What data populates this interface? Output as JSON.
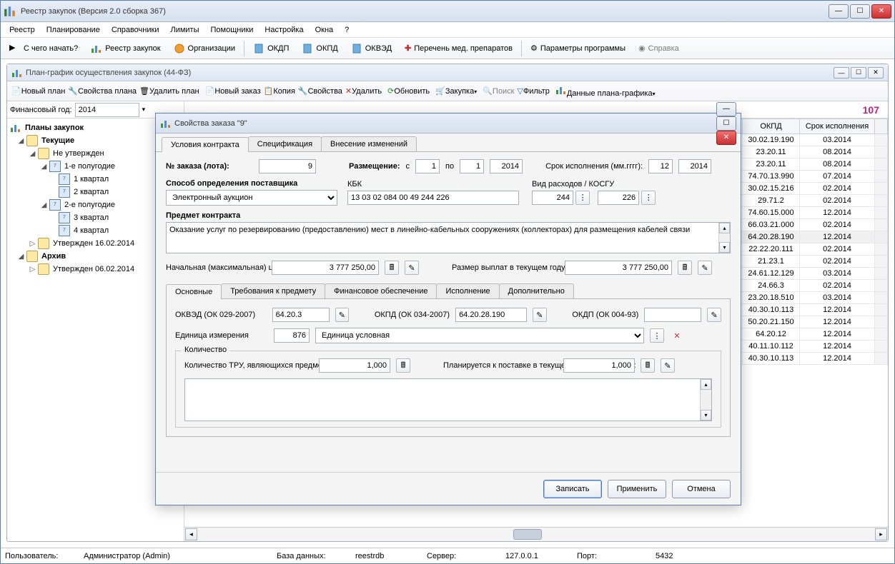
{
  "app": {
    "title": "Реестр закупок (Версия 2.0 сборка 367)"
  },
  "menu": {
    "items": [
      "Реестр",
      "Планирование",
      "Справочники",
      "Лимиты",
      "Помощники",
      "Настройка",
      "Окна",
      "?"
    ]
  },
  "maintb": {
    "start": "С чего начать?",
    "reestr": "Реестр закупок",
    "org": "Организации",
    "okdp": "ОКДП",
    "okpd": "ОКПД",
    "okved": "ОКВЭД",
    "med": "Перечень мед. препаратов",
    "params": "Параметры программы",
    "help": "Справка"
  },
  "doc": {
    "title": "План-график осуществления закупок (44-ФЗ)",
    "tb": {
      "newplan": "Новый план",
      "props": "Свойства плана",
      "delplan": "Удалить план",
      "neworder": "Новый заказ",
      "copy": "Копия",
      "orderprops": "Свойства",
      "delete": "Удалить",
      "refresh": "Обновить",
      "purchase": "Закупка",
      "search": "Поиск",
      "filter": "Фильтр",
      "plandata": "Данные плана-графика"
    },
    "finyear_label": "Финансовый год:",
    "finyear": "2014",
    "count": "107"
  },
  "tree": {
    "root": "Планы закупок",
    "current": "Текущие",
    "not_approved": "Не утвержден",
    "h1": "1-е полугодие",
    "q1": "1 квартал",
    "q2": "2 квартал",
    "h2": "2-е полугодие",
    "q3": "3 квартал",
    "q4": "4 квартал",
    "approved1": "Утвержден 16.02.2014",
    "archive": "Архив",
    "approved2": "Утвержден 06.02.2014"
  },
  "grid": {
    "col_okpd": "ОКПД",
    "col_deadline": "Срок исполнения",
    "rows": [
      {
        "okpd": "30.02.19.190",
        "d": "03.2014"
      },
      {
        "okpd": "23.20.11",
        "d": "08.2014"
      },
      {
        "okpd": "23.20.11",
        "d": "08.2014"
      },
      {
        "okpd": "74.70.13.990",
        "d": "07.2014"
      },
      {
        "okpd": "30.02.15.216",
        "d": "02.2014"
      },
      {
        "okpd": "29.71.2",
        "d": "02.2014"
      },
      {
        "okpd": "74.60.15.000",
        "d": "12.2014"
      },
      {
        "okpd": "66.03.21.000",
        "d": "02.2014"
      },
      {
        "okpd": "64.20.28.190",
        "d": "12.2014",
        "hl": true
      },
      {
        "okpd": "22.22.20.111",
        "d": "02.2014"
      },
      {
        "okpd": "21.23.1",
        "d": "02.2014"
      },
      {
        "okpd": "24.61.12.129",
        "d": "03.2014"
      },
      {
        "okpd": "24.66.3",
        "d": "02.2014"
      },
      {
        "okpd": "23.20.18.510",
        "d": "03.2014"
      },
      {
        "okpd": "40.30.10.113",
        "d": "12.2014"
      },
      {
        "okpd": "50.20.21.150",
        "d": "12.2014"
      },
      {
        "okpd": "64.20.12",
        "d": "12.2014"
      },
      {
        "okpd": "40.11.10.112",
        "d": "12.2014"
      },
      {
        "okpd": "40.30.10.113",
        "d": "12.2014"
      }
    ]
  },
  "status": {
    "user_l": "Пользователь:",
    "user_v": "Администратор (Admin)",
    "db_l": "База данных:",
    "db_v": "reestrdb",
    "srv_l": "Сервер:",
    "srv_v": "127.0.0.1",
    "port_l": "Порт:",
    "port_v": "5432"
  },
  "dlg": {
    "title": "Свойства заказа \"9\"",
    "tabs": {
      "t1": "Условия контракта",
      "t2": "Спецификация",
      "t3": "Внесение изменений"
    },
    "lot_label": "№ заказа (лота):",
    "lot": "9",
    "placement_label": "Размещение:",
    "placement_from": "с",
    "placement_from_v": "1",
    "placement_to": "по",
    "placement_to_v": "1",
    "placement_year": "2014",
    "deadline_label": "Срок исполнения (мм.гггг):",
    "deadline_mm": "12",
    "deadline_yy": "2014",
    "supplier_label": "Способ определения поставщика",
    "supplier": "Электронный аукцион",
    "kbk_label": "КБК",
    "kbk": "13 03 02 084 00 49 244 226",
    "exp_label": "Вид расходов / КОСГУ",
    "exp_vr": "244",
    "exp_kosgu": "226",
    "subject_label": "Предмет контракта",
    "subject": "Оказание услуг по резервированию (предоставлению) мест в линейно-кабельных сооружениях (коллекторах) для размещения кабелей связи",
    "price_label": "Начальная (максимальная) цена:",
    "price": "3 777 250,00",
    "pay_label": "Размер выплат в текущем году исполнения:",
    "pay": "3 777 250,00",
    "innertabs": {
      "t1": "Основные",
      "t2": "Требования к предмету",
      "t3": "Финансовое обеспечение",
      "t4": "Исполнение",
      "t5": "Дополнительно"
    },
    "okved_label": "ОКВЭД (ОК 029-2007)",
    "okved": "64.20.3",
    "okpd_label": "ОКПД (ОК 034-2007)",
    "okpd": "64.20.28.190",
    "okdp_label": "ОКДП (ОК 004-93)",
    "okdp": "",
    "unit_label": "Единица измерения",
    "unit_code": "876",
    "unit_name": "Единица условная",
    "qty_frame": "Количество",
    "qty_tru_label": "Количество ТРУ, являющихся предметом контракта",
    "qty_tru": "1,000",
    "qty_plan_label": "Планируется к поставке в текущем году исполнения:",
    "qty_plan": "1,000",
    "btn_save": "Записать",
    "btn_apply": "Применить",
    "btn_cancel": "Отмена"
  }
}
